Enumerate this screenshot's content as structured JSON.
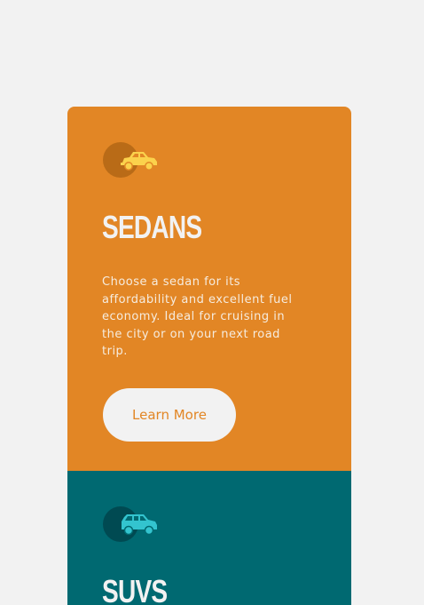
{
  "colors": {
    "page_background": "#f2f2f2",
    "sedans_background": "#e28625",
    "suvs_background": "#006971",
    "text_light": "#f2f2f2"
  },
  "cards": {
    "sedans": {
      "icon": "sedan-car-icon",
      "title": "SEDANS",
      "description": "Choose a sedan for its affordability and excellent fuel economy. Ideal for cruising in the city or on your next road trip.",
      "button_label": "Learn More"
    },
    "suvs": {
      "icon": "suv-car-icon",
      "title": "SUVS"
    }
  }
}
